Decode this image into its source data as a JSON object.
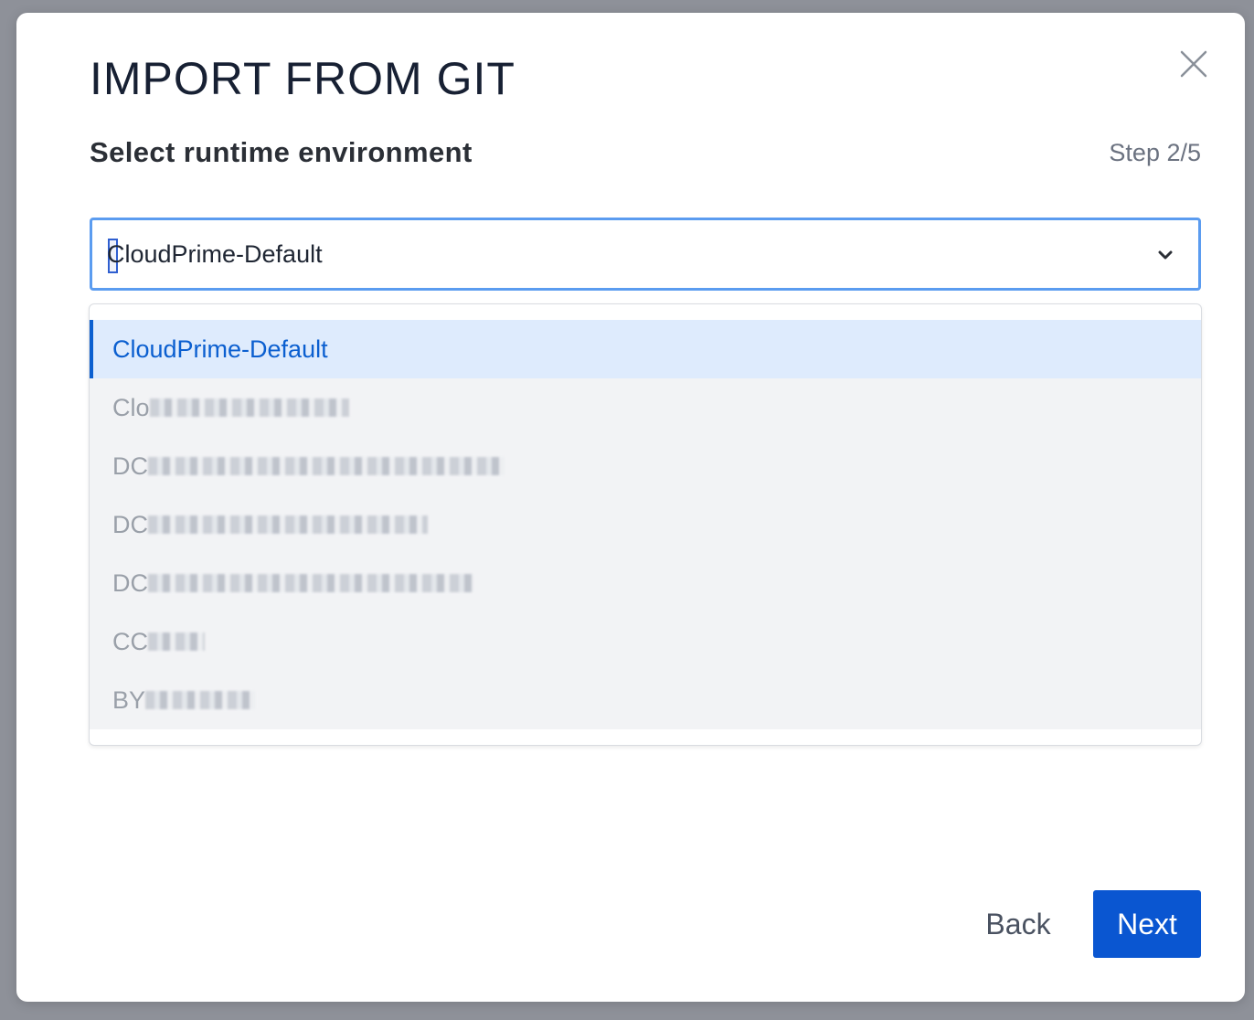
{
  "dialog": {
    "title": "IMPORT FROM GIT",
    "subtitle": "Select runtime environment",
    "step": "Step 2/5"
  },
  "select": {
    "value": "CloudPrime-Default"
  },
  "options": [
    {
      "prefix": "CloudPrime-Default",
      "selected": true
    },
    {
      "prefix": "Clo",
      "redacted": true
    },
    {
      "prefix": "DC",
      "redacted": true
    },
    {
      "prefix": "DC",
      "redacted": true
    },
    {
      "prefix": "DC",
      "redacted": true
    },
    {
      "prefix": "CC",
      "redacted": true
    },
    {
      "prefix": "BY",
      "redacted": true
    }
  ],
  "footer": {
    "back_label": "Back",
    "next_label": "Next"
  },
  "icons": {
    "close": "close-icon",
    "chevron": "chevron-down-icon"
  },
  "colors": {
    "primary": "#0a56d1",
    "focus_border": "#5b9cf0",
    "selected_bg": "#deebfd",
    "selected_text": "#0b5fd0"
  }
}
